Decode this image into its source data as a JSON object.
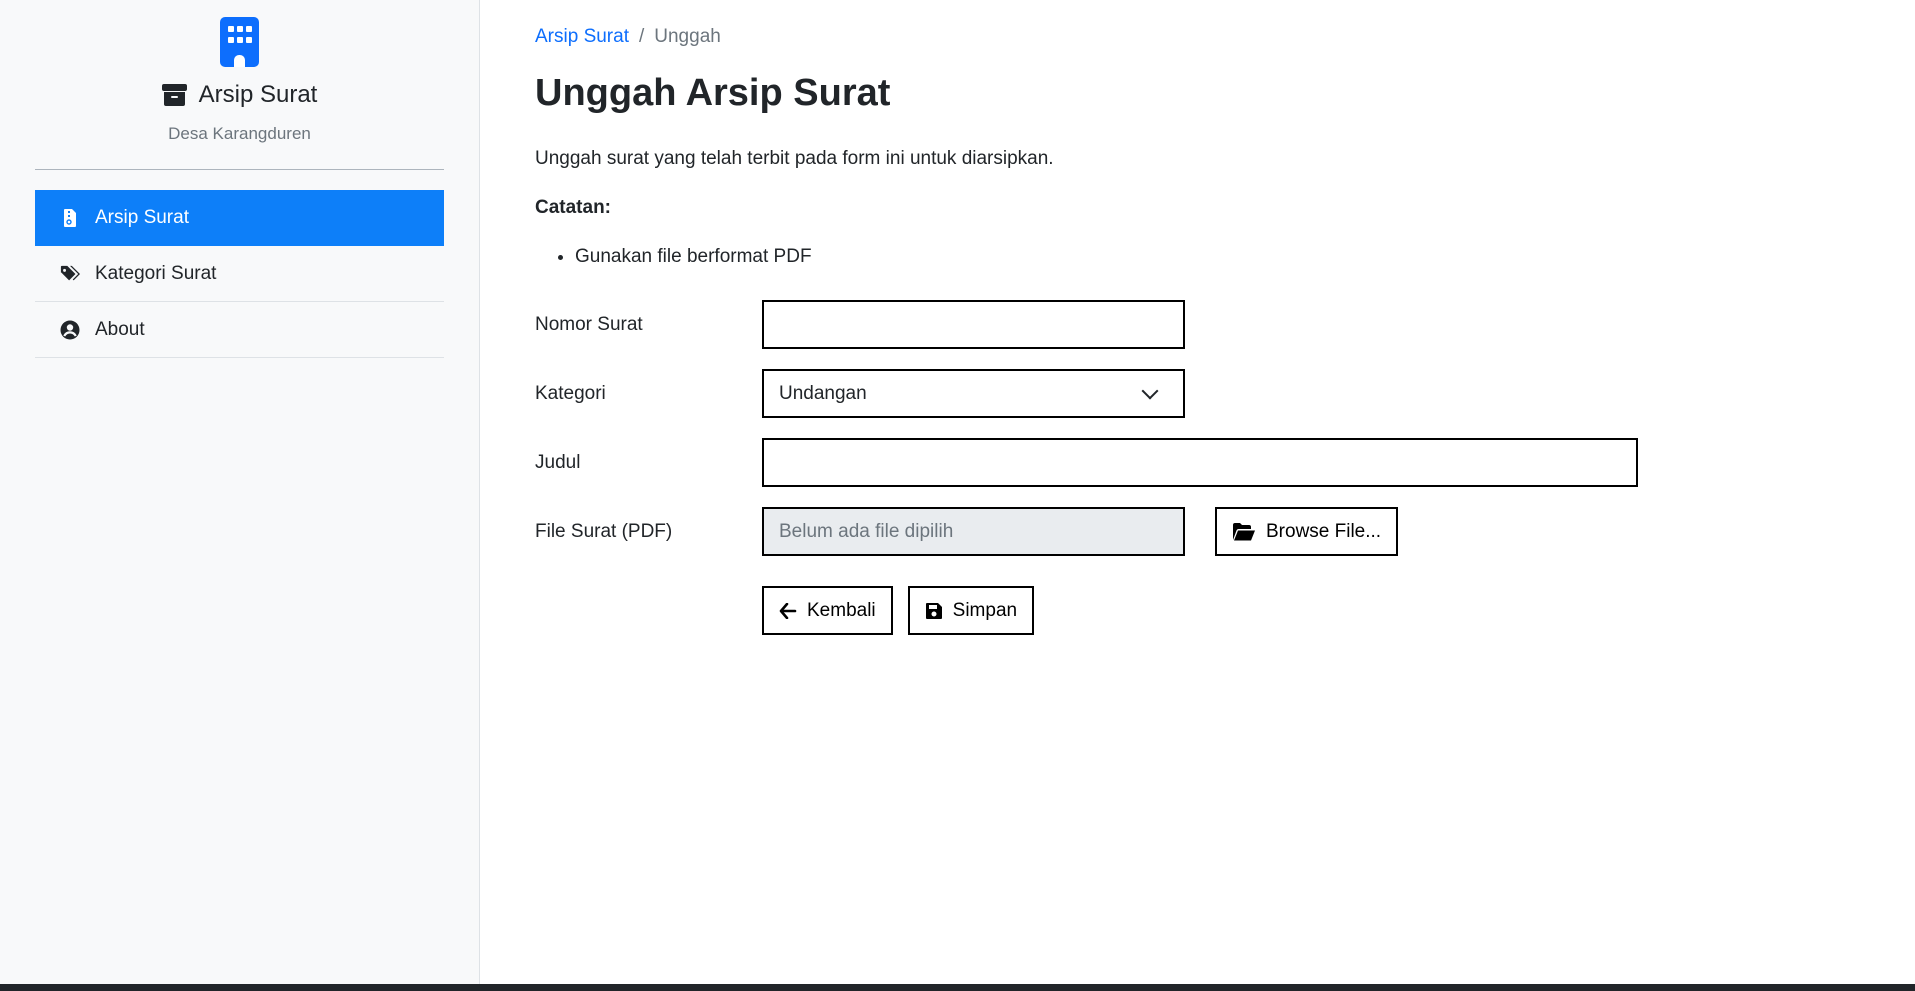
{
  "sidebar": {
    "brand_title": "Arsip Surat",
    "brand_subtitle": "Desa Karangduren",
    "items": [
      {
        "label": "Arsip Surat",
        "icon": "file-zipper-icon",
        "active": true
      },
      {
        "label": "Kategori Surat",
        "icon": "tags-icon",
        "active": false
      },
      {
        "label": "About",
        "icon": "user-circle-icon",
        "active": false
      }
    ]
  },
  "breadcrumb": {
    "parent": "Arsip Surat",
    "separator": "/",
    "current": "Unggah"
  },
  "main": {
    "title": "Unggah Arsip Surat",
    "intro": "Unggah surat yang telah terbit pada form ini untuk diarsipkan.",
    "note_title": "Catatan:",
    "notes": [
      "Gunakan file berformat PDF"
    ]
  },
  "form": {
    "nomor_label": "Nomor Surat",
    "nomor_value": "",
    "kategori_label": "Kategori",
    "kategori_value": "Undangan",
    "judul_label": "Judul",
    "judul_value": "",
    "file_label": "File Surat (PDF)",
    "file_placeholder": "Belum ada file dipilih",
    "browse_label": "Browse File...",
    "back_label": "Kembali",
    "save_label": "Simpan"
  },
  "colors": {
    "accent": "#0d7ff9",
    "sidebar_bg": "#f8f9fa",
    "link": "#0d6efd"
  }
}
